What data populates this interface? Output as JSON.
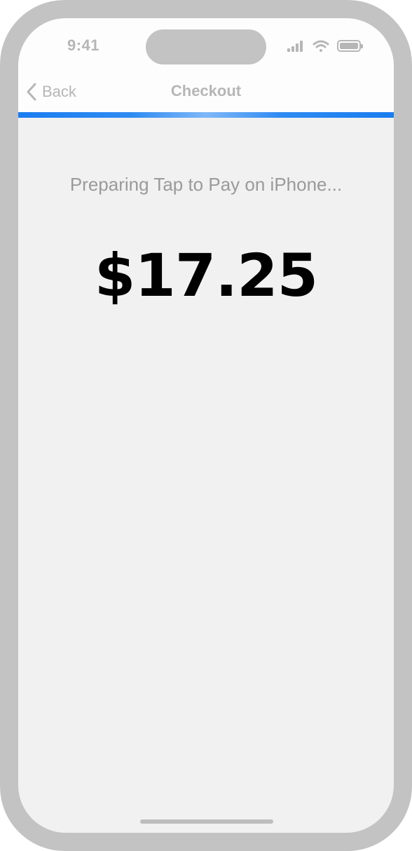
{
  "status_bar": {
    "time": "9:41",
    "icons": [
      "cellular-signal-icon",
      "wifi-icon",
      "battery-icon"
    ]
  },
  "nav": {
    "back_label": "Back",
    "title": "Checkout"
  },
  "checkout": {
    "status_message": "Preparing Tap to Pay on iPhone...",
    "amount": "$17.25"
  },
  "colors": {
    "accent": "#1a7df0",
    "background": "#f1f1f1",
    "frame": "#c3c3c3",
    "muted_text": "#9a9a9a"
  }
}
